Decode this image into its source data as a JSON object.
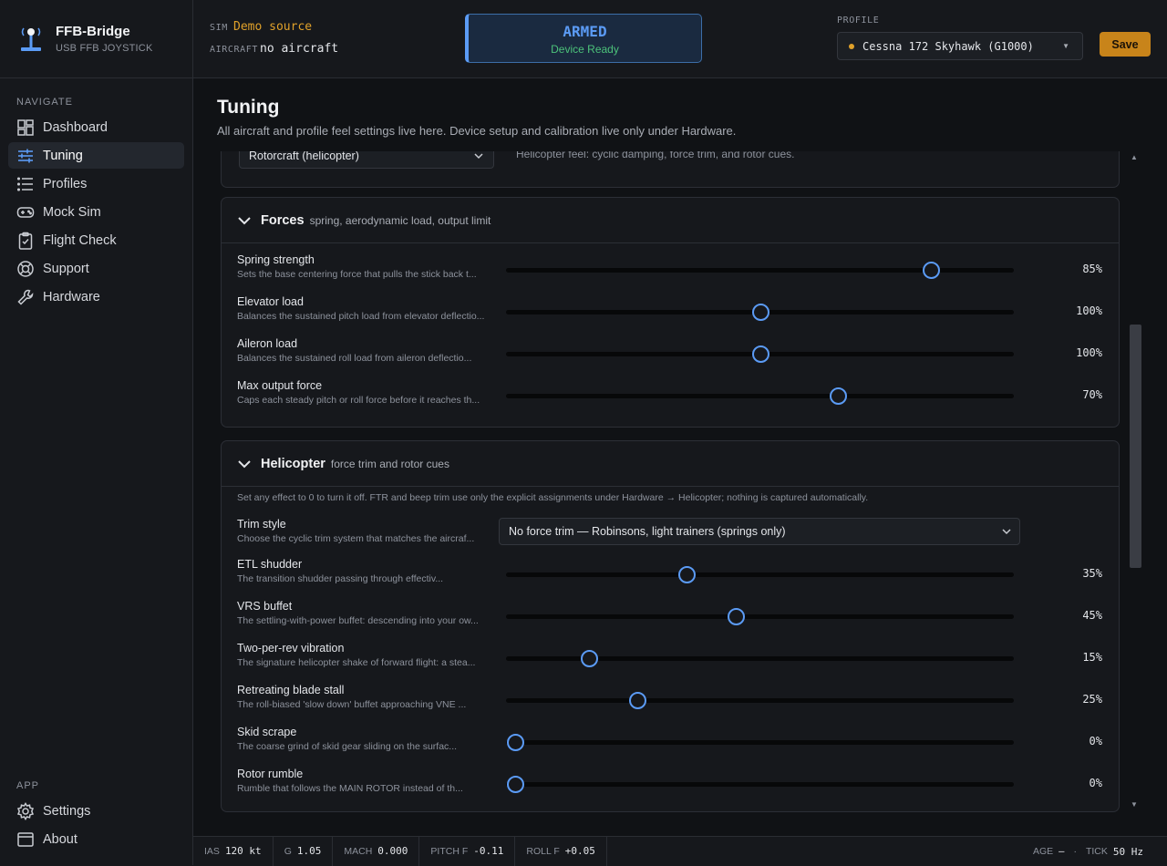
{
  "app": {
    "name": "FFB-Bridge",
    "subtitle": "USB FFB JOYSTICK"
  },
  "nav": {
    "heading": "NAVIGATE",
    "items": [
      {
        "label": "Dashboard",
        "icon": "dashboard-icon"
      },
      {
        "label": "Tuning",
        "icon": "sliders-icon",
        "active": true
      },
      {
        "label": "Profiles",
        "icon": "list-icon"
      },
      {
        "label": "Mock Sim",
        "icon": "gamepad-icon"
      },
      {
        "label": "Flight Check",
        "icon": "clipboard-icon"
      },
      {
        "label": "Support",
        "icon": "lifebuoy-icon"
      },
      {
        "label": "Hardware",
        "icon": "wrench-icon"
      }
    ]
  },
  "app_section": {
    "heading": "APP",
    "items": [
      {
        "label": "Settings",
        "icon": "gear-icon"
      },
      {
        "label": "About",
        "icon": "window-icon"
      }
    ]
  },
  "topbar": {
    "sim_label": "SIM",
    "sim_value": "Demo source",
    "aircraft_label": "AIRCRAFT",
    "aircraft_value": "no aircraft",
    "status": {
      "title": "ARMED",
      "sub": "Device Ready"
    },
    "profile_label": "PROFILE",
    "profile_value": "Cessna 172 Skyhawk (G1000)",
    "save_label": "Save"
  },
  "page": {
    "title": "Tuning",
    "subtitle": "All aircraft and profile feel settings live here. Device setup and calibration live only under Hardware."
  },
  "aircraft_type": {
    "value": "Rotorcraft (helicopter)",
    "note": "Helicopter feel: cyclic damping, force trim, and rotor cues."
  },
  "forces": {
    "title": "Forces",
    "desc": "spring, aerodynamic load, output limit",
    "rows": [
      {
        "name": "Spring strength",
        "desc": "Sets the base centering force that pulls the stick back t...",
        "value": "85%",
        "level": 0.85
      },
      {
        "name": "Elevator load",
        "desc": "Balances the sustained pitch load from elevator deflectio...",
        "value": "100%",
        "level": 0.5
      },
      {
        "name": "Aileron load",
        "desc": "Balances the sustained roll load from aileron deflectio...",
        "value": "100%",
        "level": 0.5
      },
      {
        "name": "Max output force",
        "desc": "Caps each steady pitch or roll force before it reaches th...",
        "value": "70%",
        "level": 0.66
      }
    ]
  },
  "helicopter": {
    "title": "Helicopter",
    "desc": "force trim and rotor cues",
    "note": "Set any effect to 0 to turn it off. FTR and beep trim use only the explicit assignments under Hardware → Helicopter; nothing is captured automatically.",
    "trim": {
      "name": "Trim style",
      "desc": "Choose the cyclic trim system that matches the aircraf...",
      "value": "No force trim — Robinsons, light trainers (springs only)"
    },
    "rows": [
      {
        "name": "ETL shudder",
        "desc": "The transition shudder passing through effectiv...",
        "value": "35%",
        "level": 0.35
      },
      {
        "name": "VRS buffet",
        "desc": "The settling-with-power buffet: descending into your ow...",
        "value": "45%",
        "level": 0.45
      },
      {
        "name": "Two-per-rev vibration",
        "desc": "The signature helicopter shake of forward flight: a stea...",
        "value": "15%",
        "level": 0.15
      },
      {
        "name": "Retreating blade stall",
        "desc": "The roll-biased 'slow down' buffet approaching VNE ...",
        "value": "25%",
        "level": 0.25
      },
      {
        "name": "Skid scrape",
        "desc": "The coarse grind of skid gear sliding on the surfac...",
        "value": "0%",
        "level": 0
      },
      {
        "name": "Rotor rumble",
        "desc": "Rumble that follows the MAIN ROTOR instead of th...",
        "value": "0%",
        "level": 0
      }
    ]
  },
  "telemetry": {
    "ias": {
      "label": "IAS",
      "value": "120 kt"
    },
    "g": {
      "label": "G",
      "value": "1.05"
    },
    "mach": {
      "label": "MACH",
      "value": "0.000"
    },
    "pitch": {
      "label": "PITCH F",
      "value": "-0.11"
    },
    "roll": {
      "label": "ROLL F",
      "value": "+0.05"
    },
    "age": {
      "label": "AGE",
      "value": "—"
    },
    "sep": "·",
    "tick": {
      "label": "TICK",
      "value": "50 Hz"
    }
  },
  "colors": {
    "accent": "#5b9bf5",
    "amber": "#e0a12a",
    "save": "#c8841a",
    "ready_green": "#4cc27a"
  }
}
